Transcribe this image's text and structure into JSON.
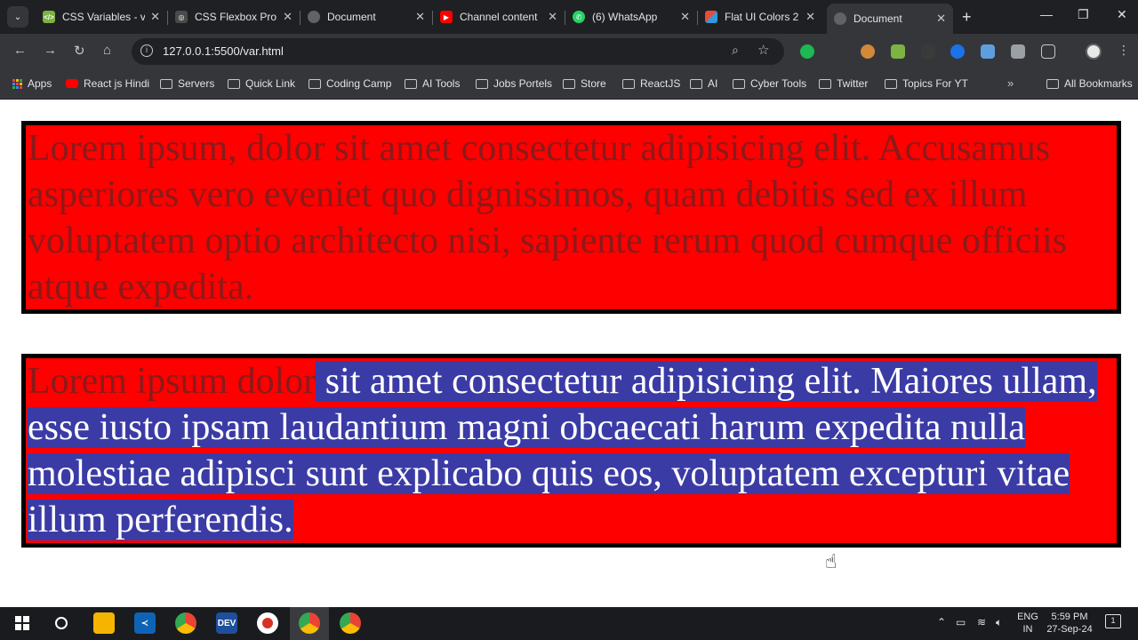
{
  "browser": {
    "tabs": [
      {
        "title": "CSS Variables - v",
        "color": "#7cb342",
        "glyph": "</>"
      },
      {
        "title": "CSS Flexbox Pro",
        "color": "#4a4a4a",
        "glyph": "◎"
      },
      {
        "title": "Document",
        "color": "#5f6368",
        "glyph": "◉"
      },
      {
        "title": "Channel content",
        "color": "#ff0000",
        "glyph": "▶"
      },
      {
        "title": "(6) WhatsApp",
        "color": "#25d366",
        "glyph": "✆"
      },
      {
        "title": "Flat UI Colors 2",
        "color": "#e67e22",
        "glyph": "■"
      },
      {
        "title": "Document",
        "color": "#5f6368",
        "glyph": "◉"
      }
    ],
    "url": "127.0.0.1:5500/var.html",
    "bookmarks": [
      {
        "label": "Apps",
        "type": "apps"
      },
      {
        "label": "React js Hindi",
        "type": "youtube"
      },
      {
        "label": "Servers",
        "type": "folder"
      },
      {
        "label": "Quick Link",
        "type": "folder"
      },
      {
        "label": "Coding Camp",
        "type": "folder"
      },
      {
        "label": "AI Tools",
        "type": "folder"
      },
      {
        "label": "Jobs Portels",
        "type": "folder"
      },
      {
        "label": "Store",
        "type": "folder"
      },
      {
        "label": "ReactJS",
        "type": "folder"
      },
      {
        "label": "AI",
        "type": "folder"
      },
      {
        "label": "Cyber Tools",
        "type": "folder"
      },
      {
        "label": "Twitter",
        "type": "folder"
      },
      {
        "label": "Topics For YT",
        "type": "folder"
      },
      {
        "label": "All Bookmarks",
        "type": "folder"
      }
    ]
  },
  "page": {
    "paragraph1": "Lorem ipsum, dolor sit amet consectetur adipisicing elit. Accusamus asperiores vero eveniet quo dignissimos, quam debitis sed ex illum voluptatem optio architecto nisi, sapiente rerum quod cumque officiis atque expedita.",
    "paragraph2_unselected": "Lorem ipsum dolor",
    "paragraph2_selected": " sit amet consectetur adipisicing elit. Maiores ullam, esse iusto ipsam laudantium magni obcaecati harum expedita nulla molestiae adipisci sunt explicabo quis eos, voluptatem excepturi vitae illum perferendis.",
    "box_background": "#ff0000",
    "selection_background": "#3b3ba6"
  },
  "taskbar": {
    "language": "ENG",
    "region": "IN",
    "time": "5:59 PM",
    "date": "27-Sep-24",
    "notification_count": "1"
  }
}
